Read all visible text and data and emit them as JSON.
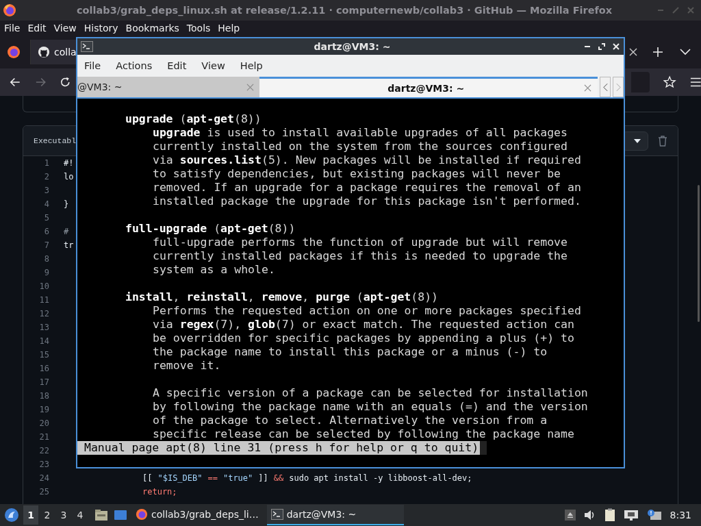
{
  "browser": {
    "title": "collab3/grab_deps_linux.sh at release/1.2.11 · computernewb/collab3 · GitHub — Mozilla Firefox",
    "menu": [
      "File",
      "Edit",
      "View",
      "History",
      "Bookmarks",
      "Tools",
      "Help"
    ],
    "tab": {
      "label": "colla",
      "selected": true
    },
    "forward": {
      "disabled": true
    },
    "file": {
      "header": "Executabl",
      "lines": [
        {
          "number": "1",
          "kind": "plain",
          "tokens": [
            {
              "text": "#!",
              "kind": "text"
            }
          ]
        },
        {
          "number": "2",
          "kind": "plain",
          "tokens": [
            {
              "text": "lo",
              "kind": "text"
            }
          ]
        },
        {
          "number": "3",
          "kind": "plain"
        },
        {
          "number": "4",
          "kind": "plain",
          "tokens": [
            {
              "text": "}",
              "kind": "text"
            }
          ]
        },
        {
          "number": "5",
          "kind": "plain"
        },
        {
          "number": "6",
          "kind": "plain",
          "tokens": [
            {
              "text": "#",
              "kind": "comment"
            }
          ]
        },
        {
          "number": "7",
          "kind": "plain",
          "tokens": [
            {
              "text": "tr",
              "kind": "text"
            }
          ]
        },
        {
          "number": "8",
          "kind": "plain"
        },
        {
          "number": "9",
          "kind": "plain"
        },
        {
          "number": "10",
          "kind": "plain"
        },
        {
          "number": "11",
          "kind": "plain"
        },
        {
          "number": "12",
          "kind": "plain"
        },
        {
          "number": "13",
          "kind": "plain"
        },
        {
          "number": "14",
          "kind": "plain"
        },
        {
          "number": "15",
          "kind": "plain"
        },
        {
          "number": "16",
          "kind": "plain"
        },
        {
          "number": "17",
          "kind": "plain"
        },
        {
          "number": "18",
          "kind": "plain"
        },
        {
          "number": "19",
          "kind": "plain"
        },
        {
          "number": "20",
          "kind": "plain"
        },
        {
          "number": "21",
          "kind": "plain"
        },
        {
          "number": "22",
          "kind": "plain"
        },
        {
          "number": "23",
          "kind": "plain"
        },
        {
          "number": "24",
          "kind": "indented",
          "tokens": [
            {
              "text": "[[",
              "kind": "text"
            },
            {
              "text": "\"$IS_DEB\"",
              "kind": "string"
            },
            {
              "text": "==",
              "kind": "operator"
            },
            {
              "text": "\"true\"",
              "kind": "string"
            },
            {
              "text": "]]",
              "kind": "text"
            },
            {
              "text": "&&",
              "kind": "operator"
            },
            {
              "text": "sudo apt install -y libboost-all-dev;",
              "kind": "text"
            }
          ]
        },
        {
          "number": "25",
          "kind": "indented",
          "tokens": [
            {
              "text": "return;",
              "kind": "operator"
            }
          ]
        }
      ]
    }
  },
  "terminal": {
    "title": "dartz@VM3: ~",
    "menu": [
      "File",
      "Actions",
      "Edit",
      "View",
      "Help"
    ],
    "tabs": [
      {
        "label": "@VM3: ~",
        "selected": false
      },
      {
        "label": "dartz@VM3: ~",
        "selected": true
      }
    ],
    "entries": [
      {
        "heading": "**upgrade** (**apt-get**(8))",
        "paragraphs": [
          [
            "**upgrade** is used to install available upgrades of all packages",
            "currently installed on the system from the sources configured",
            "via **sources.list**(5). New packages will be installed if required",
            "to satisfy dependencies, but existing packages will never be",
            "removed. If an upgrade for a package requires the removal of an",
            "installed package the upgrade for this package isn't performed."
          ]
        ]
      },
      {
        "heading": "**full-upgrade** (**apt-get**(8))",
        "paragraphs": [
          [
            "full-upgrade performs the function of upgrade but will remove",
            "currently installed packages if this is needed to upgrade the",
            "system as a whole."
          ]
        ]
      },
      {
        "heading": "**install**, **reinstall**, **remove**, **purge** (**apt-get**(8))",
        "paragraphs": [
          [
            "Performs the requested action on one or more packages specified",
            "via **regex**(7), **glob**(7) or exact match. The requested action can",
            "be overridden for specific packages by appending a plus (+) to",
            "the package name to install this package or a minus (-) to",
            "remove it."
          ],
          [
            "A specific version of a package can be selected for installation",
            "by following the package name with an equals (=) and the version",
            "of the package to select. Alternatively the version from a",
            "specific release can be selected by following the package name"
          ]
        ]
      }
    ],
    "status": "Manual page apt(8) line 31 (press h for help or q to quit)"
  },
  "taskbar": {
    "workspaces": [
      {
        "label": "1",
        "selected": true
      },
      {
        "label": "2",
        "selected": false
      },
      {
        "label": "3",
        "selected": false
      },
      {
        "label": "4",
        "selected": false
      }
    ],
    "tasks": [
      {
        "label": "collab3/grab_deps_li…",
        "kind": "browser",
        "selected": false
      },
      {
        "label": "dartz@VM3: ~",
        "kind": "terminal",
        "selected": true
      }
    ],
    "clock": "8:31"
  }
}
